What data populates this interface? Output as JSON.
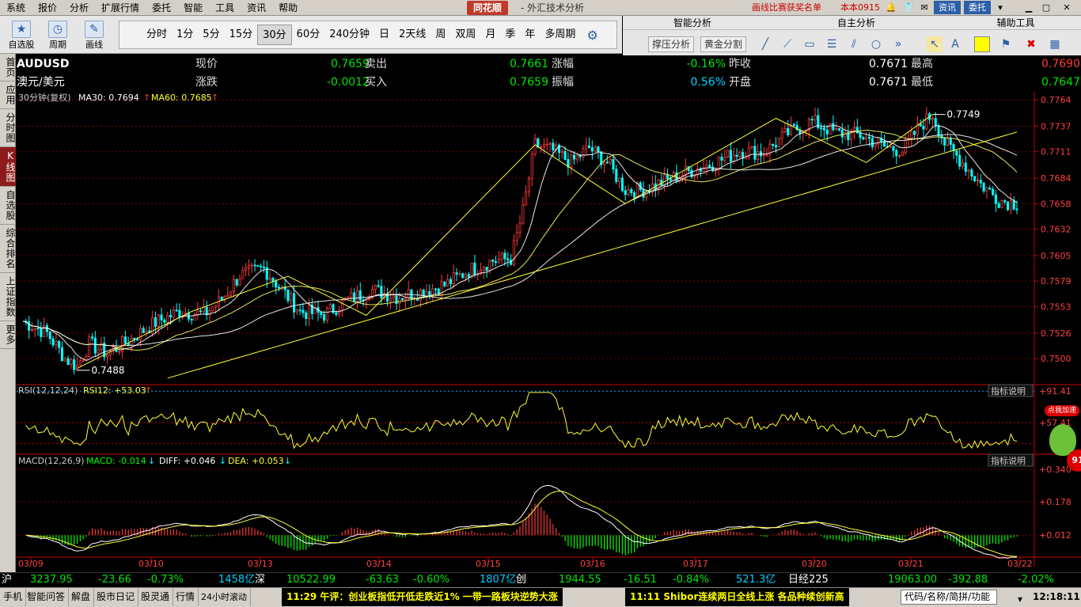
{
  "menu": {
    "items": [
      "系统",
      "报价",
      "分析",
      "扩展行情",
      "委托",
      "智能",
      "工具",
      "资讯",
      "帮助"
    ],
    "brand": "同花顺",
    "subtitle": "- 外汇技术分析",
    "promo": "画线比赛获奖名单",
    "user": "本本0915",
    "news_btn": "资讯",
    "trade_btn": "委托"
  },
  "toolbar": {
    "self_select": "自选股",
    "period_btn": "周期",
    "draw_btn": "画线",
    "periods": [
      "分时",
      "1分",
      "5分",
      "15分",
      "30分",
      "60分",
      "240分钟",
      "日",
      "2天线",
      "周",
      "双周",
      "月",
      "季",
      "年",
      "多周期"
    ],
    "active_period": "30分",
    "smart_header": "智能分析",
    "auto_header": "自主分析",
    "aux_header": "辅助工具",
    "smart_buttons": [
      "撑压分析",
      "黄金分割"
    ]
  },
  "left_tabs": [
    "首页",
    "应用",
    "分时图",
    "K线图",
    "自选股",
    "综合排名",
    "上证指数",
    "更多"
  ],
  "active_left_tab": "K线图",
  "quote": {
    "symbol": "AUDUSD",
    "name": "澳元/美元",
    "rows": [
      [
        {
          "l": "现价",
          "v": "0.7659"
        },
        {
          "l": "卖出",
          "v": "0.7661"
        },
        {
          "l": "涨幅",
          "v": "-0.16%"
        },
        {
          "l": "昨收",
          "v": "0.7671"
        },
        {
          "l": "最高",
          "v": "0.7690"
        }
      ],
      [
        {
          "l": "涨跌",
          "v": "-0.0012"
        },
        {
          "l": "买入",
          "v": "0.7659"
        },
        {
          "l": "振幅",
          "v": "0.56%"
        },
        {
          "l": "开盘",
          "v": "0.7671"
        },
        {
          "l": "最低",
          "v": "0.7647"
        }
      ]
    ]
  },
  "main_chart": {
    "header_label": "30分钟(复权)",
    "ma30_label": "MA30: 0.7694",
    "ma60_label": "MA60: 0.7685",
    "high_marker": "0.7749",
    "low_marker": "0.7488"
  },
  "rsi": {
    "label": "RSI(12,12,24)",
    "value": "RSI12: +53.03",
    "btn": "指标说明"
  },
  "macd": {
    "label": "MACD(12,26,9)",
    "macd": "MACD: -0.014",
    "diff": "DIFF: +0.046",
    "dea": "DEA: +0.053",
    "btn": "指标说明"
  },
  "chart_data": {
    "type": "candlestick",
    "x_labels": [
      "03/09",
      "03/10",
      "03/13",
      "03/14",
      "03/15",
      "03/16",
      "03/17",
      "03/20",
      "03/21",
      "03/22"
    ],
    "y_ticks": [
      "0.7764",
      "0.7737",
      "0.7711",
      "0.7684",
      "0.7658",
      "0.7632",
      "0.7605",
      "0.7579",
      "0.7553",
      "0.7526",
      "0.7500"
    ],
    "ylim": [
      0.7475,
      0.7764
    ],
    "rsi_ticks": [
      "+91.41",
      "+57.41"
    ],
    "rsi_ylim": [
      25,
      95
    ],
    "macd_ticks": [
      "+0.340",
      "+0.178",
      "+0.012"
    ],
    "macd_ylim": [
      -0.09,
      0.4
    ],
    "close_path": [
      [
        0,
        0.7538
      ],
      [
        8,
        0.7526
      ],
      [
        14,
        0.75
      ],
      [
        18,
        0.7492
      ],
      [
        22,
        0.7515
      ],
      [
        28,
        0.7505
      ],
      [
        36,
        0.752
      ],
      [
        44,
        0.7537
      ],
      [
        52,
        0.7548
      ],
      [
        60,
        0.7545
      ],
      [
        66,
        0.756
      ],
      [
        72,
        0.7585
      ],
      [
        80,
        0.7592
      ],
      [
        86,
        0.757
      ],
      [
        92,
        0.7548
      ],
      [
        100,
        0.7545
      ],
      [
        108,
        0.756
      ],
      [
        116,
        0.757
      ],
      [
        124,
        0.7563
      ],
      [
        132,
        0.7568
      ],
      [
        140,
        0.7575
      ],
      [
        148,
        0.759
      ],
      [
        156,
        0.76
      ],
      [
        162,
        0.7602
      ],
      [
        166,
        0.765
      ],
      [
        170,
        0.7718
      ],
      [
        176,
        0.7712
      ],
      [
        182,
        0.77
      ],
      [
        188,
        0.7715
      ],
      [
        194,
        0.77
      ],
      [
        200,
        0.7672
      ],
      [
        206,
        0.7672
      ],
      [
        214,
        0.7682
      ],
      [
        222,
        0.7692
      ],
      [
        230,
        0.77
      ],
      [
        238,
        0.7712
      ],
      [
        246,
        0.771
      ],
      [
        254,
        0.773
      ],
      [
        262,
        0.7742
      ],
      [
        270,
        0.773
      ],
      [
        278,
        0.7728
      ],
      [
        286,
        0.7716
      ],
      [
        292,
        0.7712
      ],
      [
        298,
        0.7738
      ],
      [
        302,
        0.7749
      ],
      [
        306,
        0.772
      ],
      [
        312,
        0.77
      ],
      [
        318,
        0.7678
      ],
      [
        324,
        0.7662
      ],
      [
        328,
        0.7659
      ]
    ],
    "trend_lines": [
      [
        [
          18,
          0.749
        ],
        [
          56,
          0.7548
        ],
        [
          88,
          0.7584
        ],
        [
          114,
          0.7544
        ],
        [
          170,
          0.7718
        ],
        [
          200,
          0.7658
        ],
        [
          250,
          0.7745
        ],
        [
          280,
          0.77
        ],
        [
          302,
          0.7749
        ]
      ],
      [
        [
          48,
          0.748
        ],
        [
          330,
          0.7731
        ]
      ]
    ],
    "n_bars": 330
  }
}
